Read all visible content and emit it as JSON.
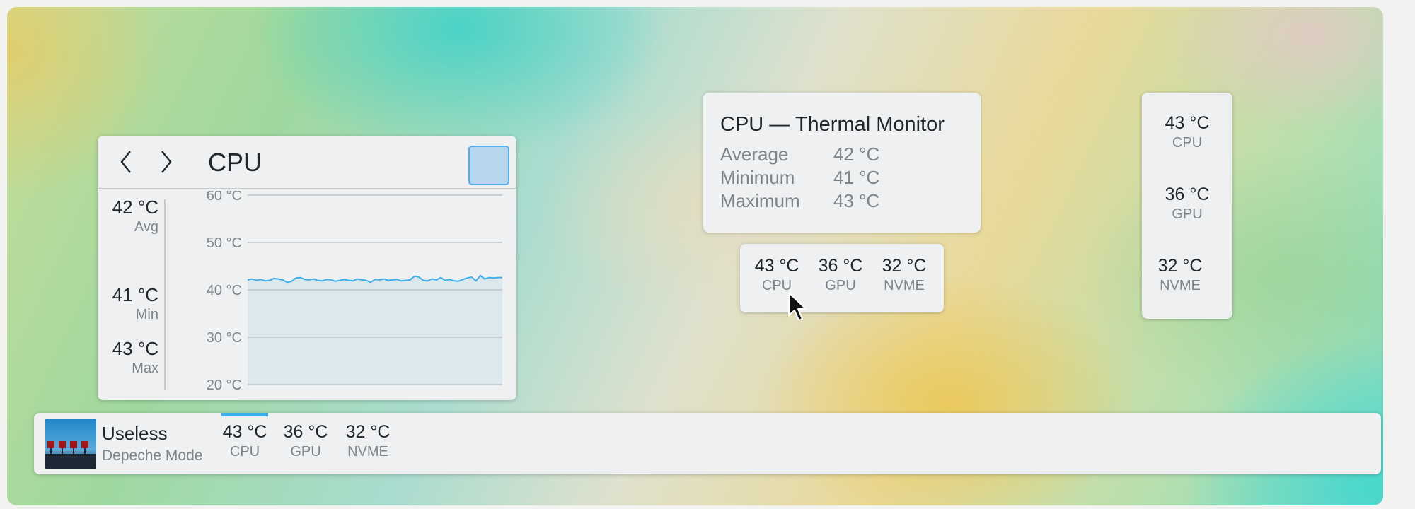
{
  "colors": {
    "accent": "#3daee9",
    "panel_background": "#eff0f1",
    "muted_text": "#7f8487",
    "graph_line": "#3daee9",
    "graph_fill": "#d4e6ec"
  },
  "cpu_widget": {
    "title": "CPU",
    "nav": {
      "back_icon": "chevron-left-icon",
      "forward_icon": "chevron-right-icon"
    },
    "tools": {
      "clear_icon": "broom-icon",
      "settings_icon": "sliders-icon",
      "pin_icon": "pin-icon",
      "pin_active": true
    },
    "stats": [
      {
        "value": "42 °C",
        "label": "Avg"
      },
      {
        "value": "41 °C",
        "label": "Min"
      },
      {
        "value": "43 °C",
        "label": "Max"
      }
    ]
  },
  "chart_data": {
    "type": "line",
    "title": "",
    "xlabel": "",
    "ylabel": "",
    "ylim": [
      20,
      60
    ],
    "y_ticks": [
      "60 °C",
      "50 °C",
      "40 °C",
      "30 °C",
      "20 °C"
    ],
    "y_tick_values": [
      60,
      50,
      40,
      30,
      20
    ],
    "grid": true,
    "filled": true,
    "series": [
      {
        "values": [
          42.1,
          42.3,
          42.0,
          42.2,
          41.9,
          42.0,
          42.4,
          42.3,
          42.1,
          41.6,
          41.8,
          42.5,
          42.6,
          42.2,
          42.1,
          42.3,
          42.0,
          41.9,
          42.2,
          42.1,
          41.8,
          42.0,
          42.2,
          42.0,
          41.9,
          42.3,
          42.1,
          42.0,
          41.6,
          42.2,
          42.1,
          42.3,
          42.0,
          42.1,
          42.2,
          41.9,
          42.0,
          42.1,
          42.9,
          42.7,
          42.0,
          41.9,
          42.3,
          42.1,
          42.6,
          42.0,
          42.2,
          41.9,
          41.8,
          42.2,
          42.5,
          42.7,
          41.9,
          43.0,
          42.3,
          42.6,
          42.5,
          42.6,
          42.6
        ]
      }
    ]
  },
  "thermal_tooltip": {
    "title": "CPU — Thermal Monitor",
    "rows": [
      {
        "label": "Average",
        "value": "42 °C"
      },
      {
        "label": "Minimum",
        "value": "41 °C"
      },
      {
        "label": "Maximum",
        "value": "43 °C"
      }
    ]
  },
  "sensor_popup": {
    "sensors": [
      {
        "value": "43 °C",
        "label": "CPU"
      },
      {
        "value": "36 °C",
        "label": "GPU"
      },
      {
        "value": "32 °C",
        "label": "NVME"
      }
    ]
  },
  "vertical_panel": {
    "sensors": [
      {
        "value": "43 °C",
        "label": "CPU"
      },
      {
        "value": "36 °C",
        "label": "GPU"
      },
      {
        "value": "32 °C",
        "label": "NVME"
      }
    ]
  },
  "taskbar": {
    "media": {
      "title": "Useless",
      "artist": "Depeche Mode",
      "album_icon": "album-art"
    },
    "sensors": [
      {
        "value": "43 °C",
        "label": "CPU"
      },
      {
        "value": "36 °C",
        "label": "GPU"
      },
      {
        "value": "32 °C",
        "label": "NVME"
      }
    ],
    "active_sensor": "CPU"
  },
  "cursor_icon": "mouse-pointer-icon"
}
